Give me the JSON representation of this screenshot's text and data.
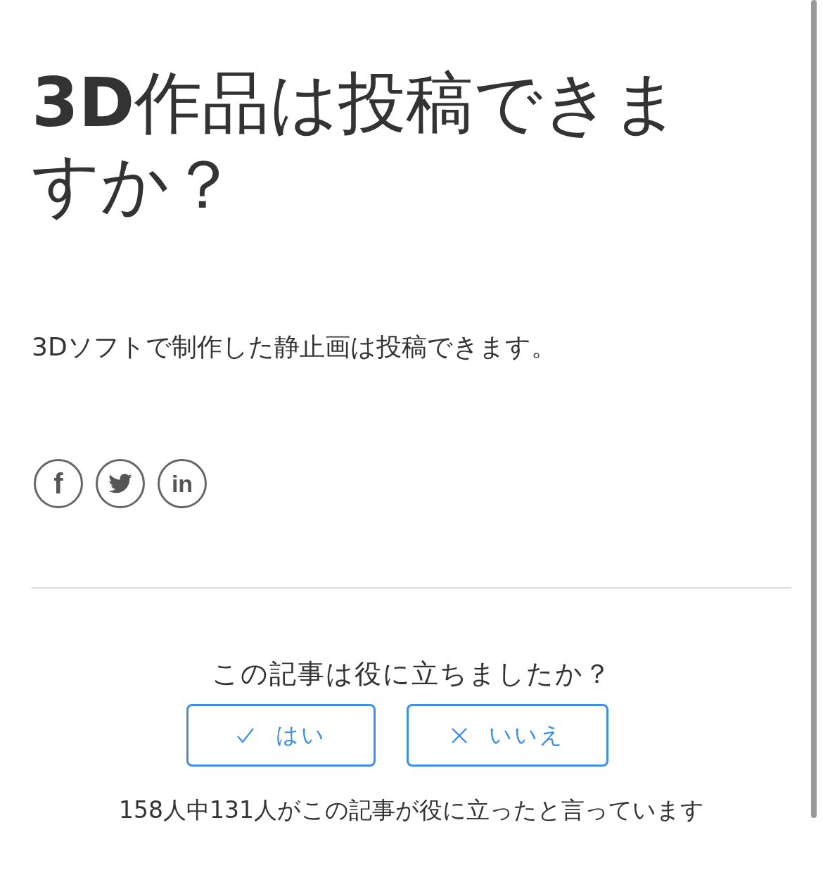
{
  "title": "**3D**作品は投稿できますか？",
  "body": "3Dソフトで制作した静止画は投稿できます。",
  "share_buttons": [
    {
      "kind": "facebook",
      "glyph": "f"
    },
    {
      "kind": "twitter"
    },
    {
      "kind": "linkedin",
      "glyph": "in"
    }
  ],
  "feedback": {
    "question": "この記事は役に立ちましたか？",
    "buttons": [
      {
        "kind": "yes",
        "label": "はい"
      },
      {
        "kind": "no",
        "label": "いいえ"
      }
    ],
    "stats": "158人中131人がこの記事が役に立ったと言っています"
  }
}
